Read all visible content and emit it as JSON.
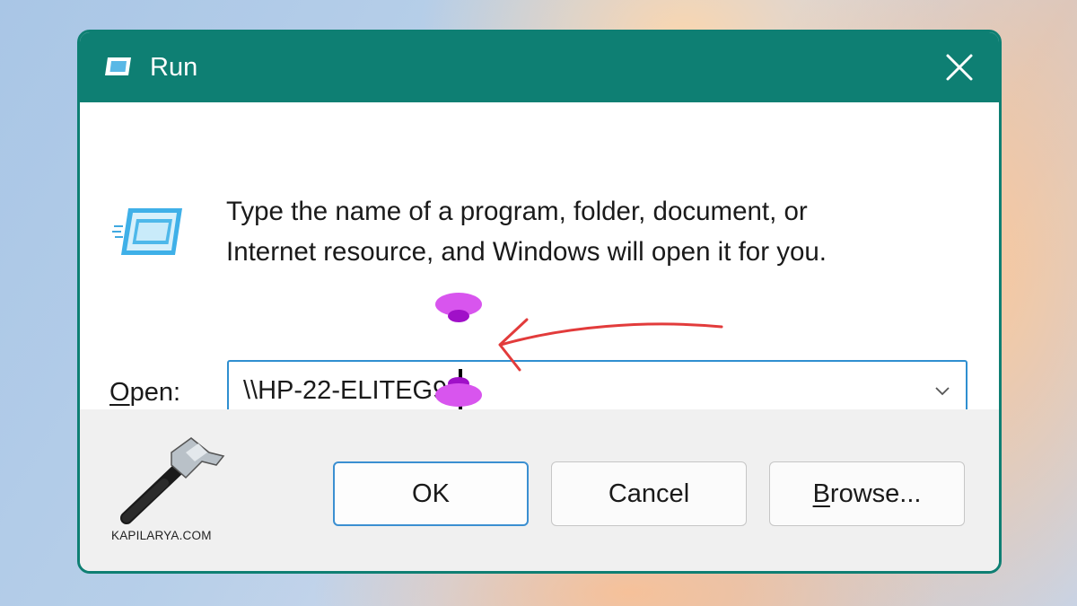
{
  "window": {
    "title": "Run",
    "title_icon": "run-icon",
    "close_icon": "close-icon",
    "accent_color": "#0e7f73"
  },
  "content": {
    "icon": "run-program-icon",
    "description_line1": "Type the name of a program, folder, document, or",
    "description_line2": "Internet resource, and Windows will open it for you.",
    "open_label_accel": "O",
    "open_label_rest": "pen:",
    "input_value": "\\\\HP-22-ELITEG9",
    "dropdown_icon": "chevron-down-icon"
  },
  "buttons": {
    "ok_label": "OK",
    "cancel_label": "Cancel",
    "browse_accel": "B",
    "browse_rest": "rowse..."
  },
  "watermark": {
    "text": "KAPILARYA.COM",
    "icon": "hammer-icon"
  },
  "annotation": {
    "arrow_color": "#e23b3b",
    "handle_color": "#d24ee6"
  }
}
